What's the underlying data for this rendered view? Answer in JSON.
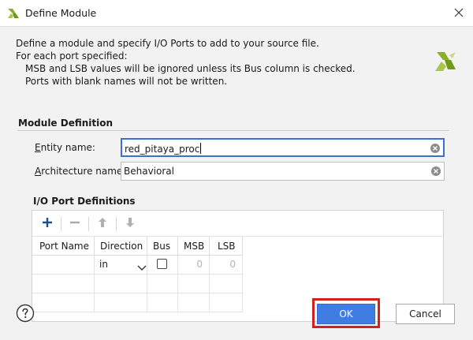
{
  "window": {
    "title": "Define Module",
    "app_icon": "vivado-logo-icon",
    "close_icon": "close-icon"
  },
  "intro": {
    "line1": "Define a module and specify I/O Ports to add to your source file.",
    "line2": "For each port specified:",
    "line3": "MSB and LSB values will be ignored unless its Bus column is checked.",
    "line4": "Ports with blank names will not be written."
  },
  "module_definition": {
    "section_title": "Module Definition",
    "entity": {
      "label_hotkey": "E",
      "label_rest": "ntity name:",
      "value": "red_pitaya_proc"
    },
    "architecture": {
      "label_hotkey": "A",
      "label_rest": "rchitecture name:",
      "value": "Behavioral"
    }
  },
  "io_ports": {
    "section_title": "I/O Port Definitions",
    "toolbar": [
      "add-icon",
      "remove-icon",
      "move-up-icon",
      "move-down-icon"
    ],
    "columns": [
      "Port Name",
      "Direction",
      "Bus",
      "MSB",
      "LSB"
    ],
    "rows": [
      {
        "port_name": "",
        "direction": "in",
        "bus": false,
        "msb": "0",
        "lsb": "0"
      }
    ]
  },
  "footer": {
    "help_icon": "help-icon",
    "ok_label": "OK",
    "cancel_label": "Cancel"
  },
  "colors": {
    "ok_button": "#3f7de3",
    "highlight_box": "#d62020",
    "focus_border": "#3b6fd1",
    "dialog_background": "#f2f2f2"
  }
}
